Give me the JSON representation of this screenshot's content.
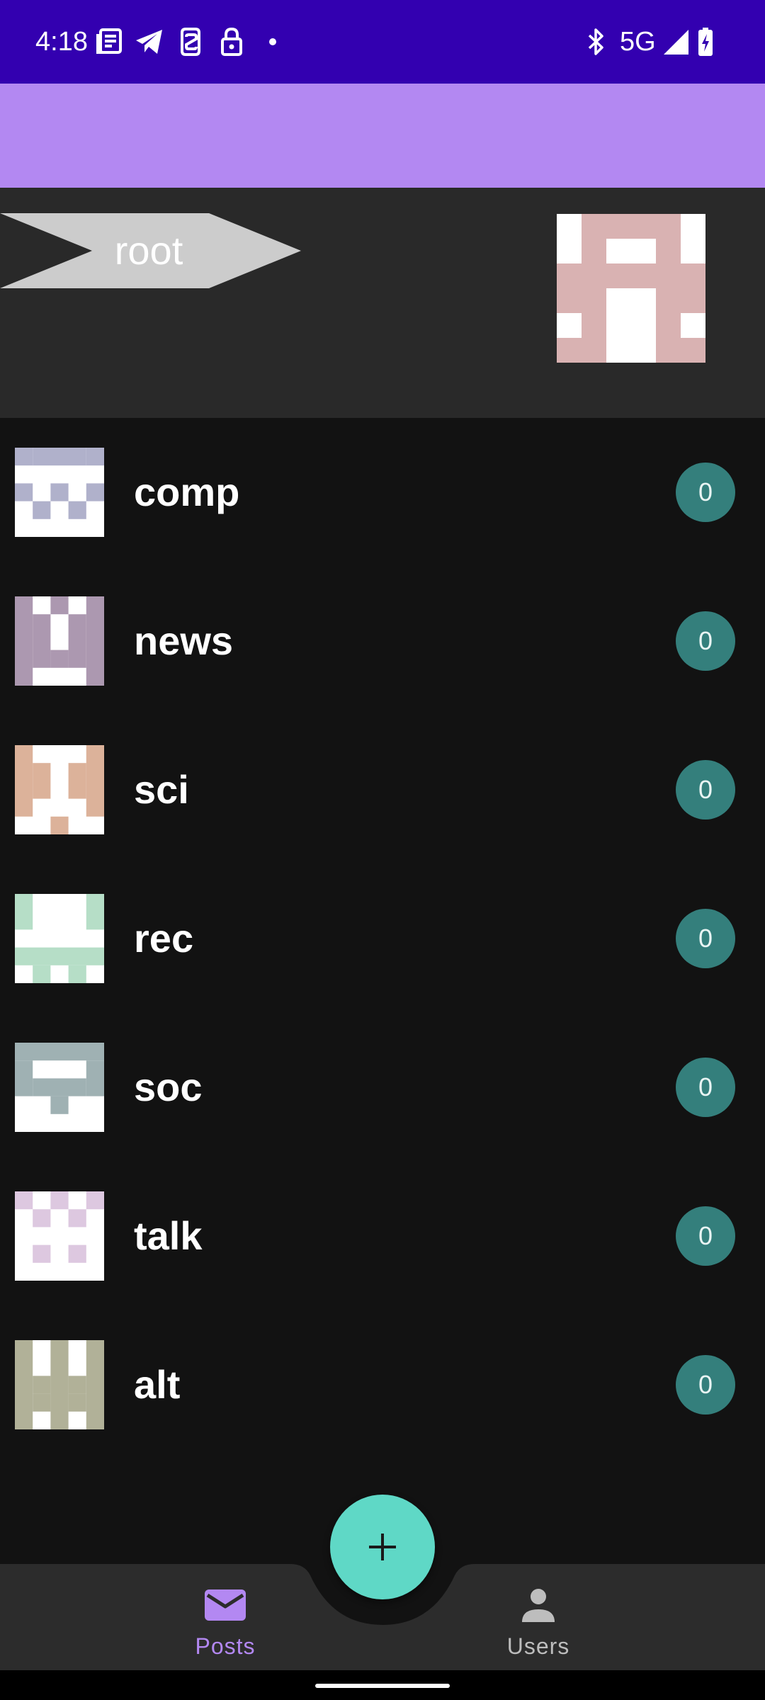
{
  "status_bar": {
    "time": "4:18",
    "network": "5G",
    "left_icons": [
      "news-icon",
      "telegram-icon",
      "vpn-icon",
      "lock-icon",
      "dot-icon"
    ],
    "right_icons": [
      "bluetooth-icon",
      "signal-icon",
      "battery-charging-icon"
    ]
  },
  "header": {
    "root_label": "root",
    "root_tag_color": "#CCCCCC",
    "avatar_color": "#D9B2B2"
  },
  "groups": [
    {
      "label": "comp",
      "count": "0",
      "color": "#B0B1CB"
    },
    {
      "label": "news",
      "count": "0",
      "color": "#AC98B0"
    },
    {
      "label": "sci",
      "count": "0",
      "color": "#DCB29A"
    },
    {
      "label": "rec",
      "count": "0",
      "color": "#B6DEC7"
    },
    {
      "label": "soc",
      "count": "0",
      "color": "#9FB1B3"
    },
    {
      "label": "talk",
      "count": "0",
      "color": "#DDC8E0"
    },
    {
      "label": "alt",
      "count": "0",
      "color": "#B1B198"
    }
  ],
  "bottom_nav": {
    "posts_label": "Posts",
    "users_label": "Users",
    "active": "Posts",
    "active_color": "#B388F2",
    "inactive_color": "#BDBDBD"
  },
  "fab": {
    "icon": "plus-icon",
    "color": "#5FD8C6"
  },
  "colors": {
    "status_bar": "#3300B0",
    "app_bar": "#B388F2",
    "header_bg": "#292929",
    "list_bg": "#121212",
    "badge": "#347F7C"
  }
}
